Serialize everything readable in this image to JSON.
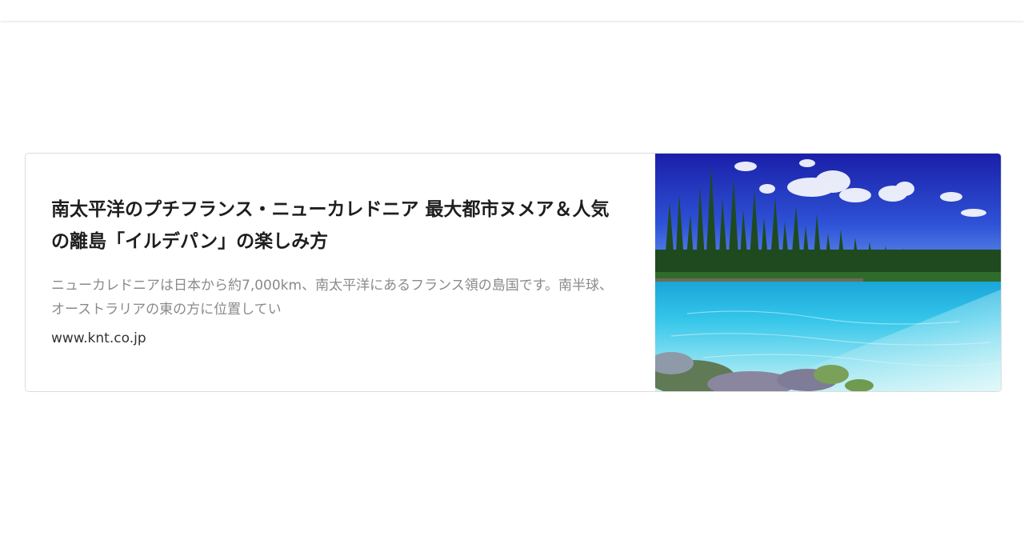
{
  "card": {
    "title": "南太平洋のプチフランス・ニューカレドニア 最大都市ヌメア＆人気の離島「イルデパン」の楽しみ方",
    "description": "ニューカレドニアは日本から約7,000km、南太平洋にあるフランス領の島国です。南半球、オーストラリアの東の方に位置してい",
    "domain": "www.knt.co.jp"
  },
  "colors": {
    "title": "#1e1e1e",
    "description": "#8a8a8a",
    "domain": "#333333",
    "border": "#dcdcdc"
  }
}
